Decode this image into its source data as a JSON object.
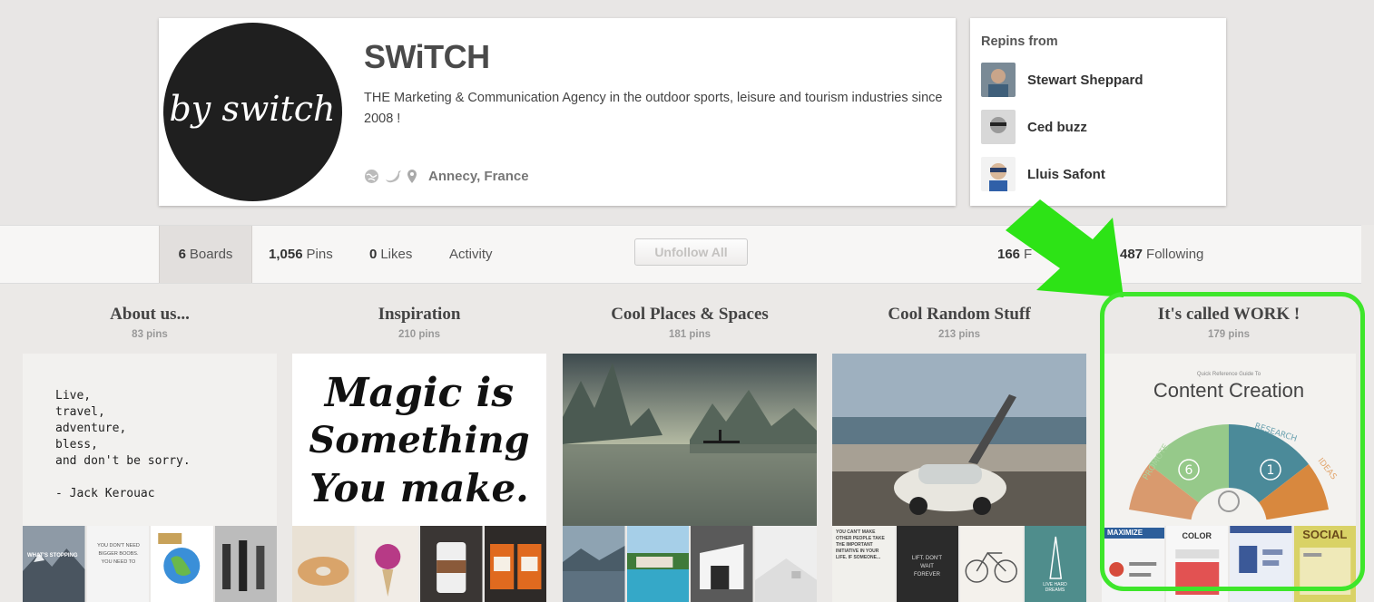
{
  "profile": {
    "name": "SWiTCH",
    "description": "THE Marketing & Communication Agency in the outdoor sports, leisure and tourism industries since 2008 !",
    "location": "Annecy, France",
    "avatar_text": "by switch"
  },
  "repins": {
    "title": "Repins from",
    "users": [
      {
        "name": "Stewart Sheppard"
      },
      {
        "name": "Ced buzz"
      },
      {
        "name": "Lluis Safont"
      }
    ]
  },
  "nav": {
    "boards": {
      "count": "6",
      "label": "Boards"
    },
    "pins": {
      "count": "1,056",
      "label": "Pins"
    },
    "likes": {
      "count": "0",
      "label": "Likes"
    },
    "activity": {
      "label": "Activity"
    },
    "unfollow_label": "Unfollow All",
    "followers": {
      "count": "166",
      "label": "F"
    },
    "following": {
      "count": "487",
      "label": "Following"
    }
  },
  "boards": [
    {
      "title": "About us...",
      "count": "83 pins",
      "quote": "Live,\ntravel,\nadventure,\nbless,\nand don't be sorry.\n\n- Jack Kerouac",
      "thumb_texts": [
        "WHAT'S STOPPING",
        "YOU DON'T NEED BIGGER BOOBS. YOU NEED TO"
      ]
    },
    {
      "title": "Inspiration",
      "count": "210 pins",
      "lines": [
        "Magic is",
        "Something",
        "You make."
      ]
    },
    {
      "title": "Cool Places & Spaces",
      "count": "181 pins"
    },
    {
      "title": "Cool Random Stuff",
      "count": "213 pins",
      "thumb_texts": [
        "YOU CAN'T MAKE OTHER PEOPLE TAKE THE IMPORTANT INITIATIVE IN YOUR LIFE. IF SOMEONE...",
        "LIFT. DON'T WAIT FOREVER",
        "",
        "LIVE HARD DREAMS"
      ]
    },
    {
      "title": "It's called WORK !",
      "count": "179 pins",
      "cover_small": "Quick Reference Guide To",
      "cover_title": "Content Creation",
      "wheel_labels": [
        "RESEARCH",
        "PROMOTE",
        "IDEAS"
      ],
      "wheel_numbers": [
        "6",
        "1"
      ],
      "thumb_texts": [
        "MAXIMIZE",
        "COLOR",
        "",
        "SOCIAL"
      ]
    }
  ],
  "colors": {
    "highlight": "#3ee62b",
    "arrow": "#2de316",
    "avatar_bg": "#1f1f1f"
  }
}
